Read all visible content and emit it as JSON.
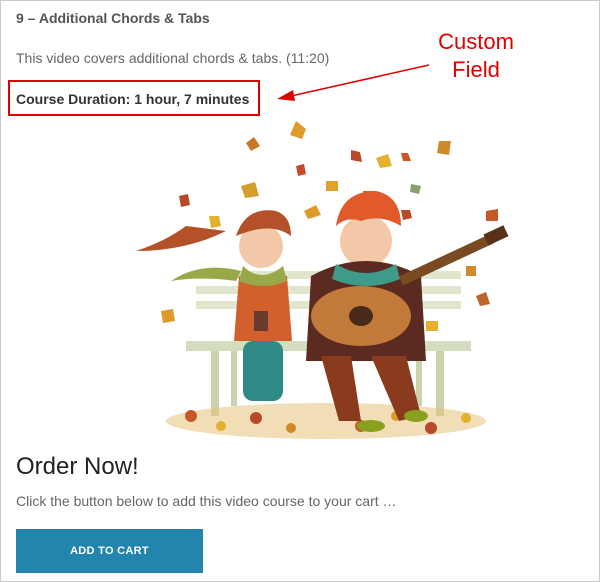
{
  "lesson": {
    "title": "9 – Additional Chords & Tabs",
    "description": "This video covers additional chords & tabs. (11:20)"
  },
  "custom_field": {
    "text": "Course Duration: 1 hour, 7 minutes"
  },
  "annotation": {
    "line1": "Custom",
    "line2": "Field",
    "color": "#e00000"
  },
  "illustration": {
    "subject": "couple on bench with guitar among autumn leaves"
  },
  "order": {
    "title": "Order Now!",
    "description": "Click the button below to add this video course to your cart …",
    "button_label": "ADD TO CART",
    "button_color": "#2385ad"
  }
}
